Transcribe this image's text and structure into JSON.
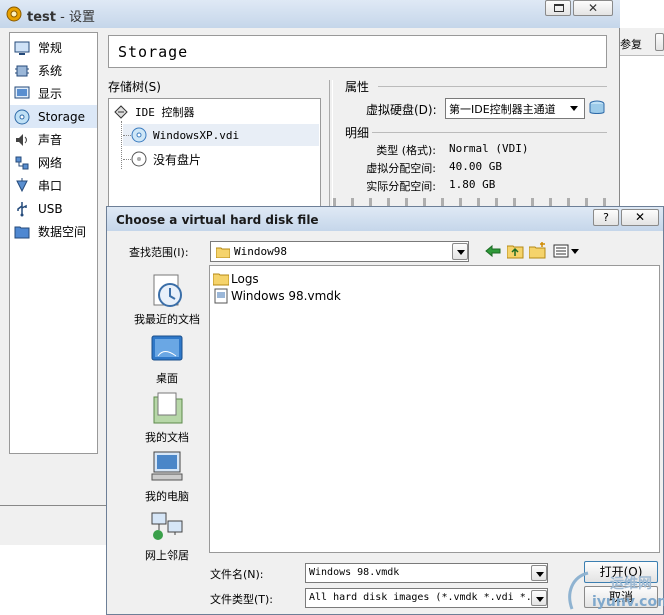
{
  "settings": {
    "title_app": "test",
    "title_sep": " - ",
    "title_page": "设置",
    "title_cutoff": "参复",
    "sidebar": [
      {
        "label": "常规",
        "icon": "monitor-icon"
      },
      {
        "label": "系统",
        "icon": "chip-icon"
      },
      {
        "label": "显示",
        "icon": "display-icon"
      },
      {
        "label": "Storage",
        "icon": "disk-icon"
      },
      {
        "label": "声音",
        "icon": "speaker-icon"
      },
      {
        "label": "网络",
        "icon": "network-icon"
      },
      {
        "label": "串口",
        "icon": "serial-port-icon"
      },
      {
        "label": "USB",
        "icon": "usb-icon"
      },
      {
        "label": "数据空间",
        "icon": "folder-icon"
      }
    ],
    "section_title": "Storage",
    "tree_label": "存储树(S)",
    "tree": {
      "controller": "IDE 控制器",
      "disk": "WindowsXP.vdi",
      "empty": "没有盘片"
    },
    "attributes_label": "属性",
    "virtual_disk_label": "虚拟硬盘(D):",
    "virtual_disk_value": "第一IDE控制器主通道",
    "details_label": "明细",
    "details": [
      {
        "key": "类型 (格式):",
        "value": "Normal (VDI)"
      },
      {
        "key": "虚拟分配空间:",
        "value": "40.00 GB"
      },
      {
        "key": "实际分配空间:",
        "value": "1.80 GB"
      }
    ]
  },
  "dialog": {
    "title": "Choose a virtual hard disk file",
    "lookin_label": "查找范围(I):",
    "lookin_value": "Window98",
    "places": [
      {
        "label": "我最近的文档",
        "icon": "recent-documents-icon"
      },
      {
        "label": "桌面",
        "icon": "desktop-icon"
      },
      {
        "label": "我的文档",
        "icon": "my-documents-icon"
      },
      {
        "label": "我的电脑",
        "icon": "my-computer-icon"
      },
      {
        "label": "网上邻居",
        "icon": "network-places-icon"
      }
    ],
    "files": [
      {
        "name": "Logs",
        "icon": "folder-icon"
      },
      {
        "name": "Windows 98.vmdk",
        "icon": "vmdk-file-icon"
      }
    ],
    "filename_label": "文件名(N):",
    "filename_value": "Windows 98.vmdk",
    "filetype_label": "文件类型(T):",
    "filetype_value": "All hard disk images (*.vmdk *.vdi *.",
    "open_button": "打开(O)",
    "cancel_button": "取消",
    "help_button": "?"
  },
  "watermark": {
    "line1": "运维网",
    "line2": "iyunv.com"
  }
}
